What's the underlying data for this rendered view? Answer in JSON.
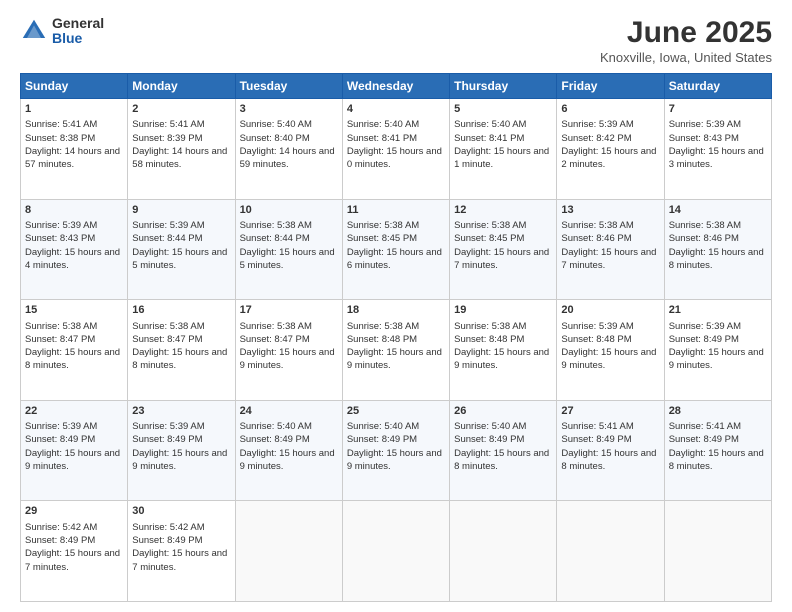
{
  "logo": {
    "general": "General",
    "blue": "Blue"
  },
  "header": {
    "month": "June 2025",
    "location": "Knoxville, Iowa, United States"
  },
  "weekdays": [
    "Sunday",
    "Monday",
    "Tuesday",
    "Wednesday",
    "Thursday",
    "Friday",
    "Saturday"
  ],
  "weeks": [
    [
      {
        "day": "1",
        "sunrise": "Sunrise: 5:41 AM",
        "sunset": "Sunset: 8:38 PM",
        "daylight": "Daylight: 14 hours and 57 minutes."
      },
      {
        "day": "2",
        "sunrise": "Sunrise: 5:41 AM",
        "sunset": "Sunset: 8:39 PM",
        "daylight": "Daylight: 14 hours and 58 minutes."
      },
      {
        "day": "3",
        "sunrise": "Sunrise: 5:40 AM",
        "sunset": "Sunset: 8:40 PM",
        "daylight": "Daylight: 14 hours and 59 minutes."
      },
      {
        "day": "4",
        "sunrise": "Sunrise: 5:40 AM",
        "sunset": "Sunset: 8:41 PM",
        "daylight": "Daylight: 15 hours and 0 minutes."
      },
      {
        "day": "5",
        "sunrise": "Sunrise: 5:40 AM",
        "sunset": "Sunset: 8:41 PM",
        "daylight": "Daylight: 15 hours and 1 minute."
      },
      {
        "day": "6",
        "sunrise": "Sunrise: 5:39 AM",
        "sunset": "Sunset: 8:42 PM",
        "daylight": "Daylight: 15 hours and 2 minutes."
      },
      {
        "day": "7",
        "sunrise": "Sunrise: 5:39 AM",
        "sunset": "Sunset: 8:43 PM",
        "daylight": "Daylight: 15 hours and 3 minutes."
      }
    ],
    [
      {
        "day": "8",
        "sunrise": "Sunrise: 5:39 AM",
        "sunset": "Sunset: 8:43 PM",
        "daylight": "Daylight: 15 hours and 4 minutes."
      },
      {
        "day": "9",
        "sunrise": "Sunrise: 5:39 AM",
        "sunset": "Sunset: 8:44 PM",
        "daylight": "Daylight: 15 hours and 5 minutes."
      },
      {
        "day": "10",
        "sunrise": "Sunrise: 5:38 AM",
        "sunset": "Sunset: 8:44 PM",
        "daylight": "Daylight: 15 hours and 5 minutes."
      },
      {
        "day": "11",
        "sunrise": "Sunrise: 5:38 AM",
        "sunset": "Sunset: 8:45 PM",
        "daylight": "Daylight: 15 hours and 6 minutes."
      },
      {
        "day": "12",
        "sunrise": "Sunrise: 5:38 AM",
        "sunset": "Sunset: 8:45 PM",
        "daylight": "Daylight: 15 hours and 7 minutes."
      },
      {
        "day": "13",
        "sunrise": "Sunrise: 5:38 AM",
        "sunset": "Sunset: 8:46 PM",
        "daylight": "Daylight: 15 hours and 7 minutes."
      },
      {
        "day": "14",
        "sunrise": "Sunrise: 5:38 AM",
        "sunset": "Sunset: 8:46 PM",
        "daylight": "Daylight: 15 hours and 8 minutes."
      }
    ],
    [
      {
        "day": "15",
        "sunrise": "Sunrise: 5:38 AM",
        "sunset": "Sunset: 8:47 PM",
        "daylight": "Daylight: 15 hours and 8 minutes."
      },
      {
        "day": "16",
        "sunrise": "Sunrise: 5:38 AM",
        "sunset": "Sunset: 8:47 PM",
        "daylight": "Daylight: 15 hours and 8 minutes."
      },
      {
        "day": "17",
        "sunrise": "Sunrise: 5:38 AM",
        "sunset": "Sunset: 8:47 PM",
        "daylight": "Daylight: 15 hours and 9 minutes."
      },
      {
        "day": "18",
        "sunrise": "Sunrise: 5:38 AM",
        "sunset": "Sunset: 8:48 PM",
        "daylight": "Daylight: 15 hours and 9 minutes."
      },
      {
        "day": "19",
        "sunrise": "Sunrise: 5:38 AM",
        "sunset": "Sunset: 8:48 PM",
        "daylight": "Daylight: 15 hours and 9 minutes."
      },
      {
        "day": "20",
        "sunrise": "Sunrise: 5:39 AM",
        "sunset": "Sunset: 8:48 PM",
        "daylight": "Daylight: 15 hours and 9 minutes."
      },
      {
        "day": "21",
        "sunrise": "Sunrise: 5:39 AM",
        "sunset": "Sunset: 8:49 PM",
        "daylight": "Daylight: 15 hours and 9 minutes."
      }
    ],
    [
      {
        "day": "22",
        "sunrise": "Sunrise: 5:39 AM",
        "sunset": "Sunset: 8:49 PM",
        "daylight": "Daylight: 15 hours and 9 minutes."
      },
      {
        "day": "23",
        "sunrise": "Sunrise: 5:39 AM",
        "sunset": "Sunset: 8:49 PM",
        "daylight": "Daylight: 15 hours and 9 minutes."
      },
      {
        "day": "24",
        "sunrise": "Sunrise: 5:40 AM",
        "sunset": "Sunset: 8:49 PM",
        "daylight": "Daylight: 15 hours and 9 minutes."
      },
      {
        "day": "25",
        "sunrise": "Sunrise: 5:40 AM",
        "sunset": "Sunset: 8:49 PM",
        "daylight": "Daylight: 15 hours and 9 minutes."
      },
      {
        "day": "26",
        "sunrise": "Sunrise: 5:40 AM",
        "sunset": "Sunset: 8:49 PM",
        "daylight": "Daylight: 15 hours and 8 minutes."
      },
      {
        "day": "27",
        "sunrise": "Sunrise: 5:41 AM",
        "sunset": "Sunset: 8:49 PM",
        "daylight": "Daylight: 15 hours and 8 minutes."
      },
      {
        "day": "28",
        "sunrise": "Sunrise: 5:41 AM",
        "sunset": "Sunset: 8:49 PM",
        "daylight": "Daylight: 15 hours and 8 minutes."
      }
    ],
    [
      {
        "day": "29",
        "sunrise": "Sunrise: 5:42 AM",
        "sunset": "Sunset: 8:49 PM",
        "daylight": "Daylight: 15 hours and 7 minutes."
      },
      {
        "day": "30",
        "sunrise": "Sunrise: 5:42 AM",
        "sunset": "Sunset: 8:49 PM",
        "daylight": "Daylight: 15 hours and 7 minutes."
      },
      null,
      null,
      null,
      null,
      null
    ]
  ]
}
